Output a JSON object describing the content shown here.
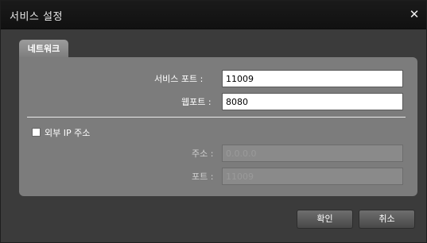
{
  "window": {
    "title": "서비스 설정",
    "close_icon": "close-icon"
  },
  "tab": {
    "label": "네트워크"
  },
  "fields": {
    "service_port": {
      "label": "서비스 포트 :",
      "value": "11009"
    },
    "web_port": {
      "label": "웹포트 :",
      "value": "8080"
    },
    "external_ip": {
      "label": "외부 IP 주소",
      "checked": false
    },
    "address": {
      "label": "주소 :",
      "value": "0.0.0.0"
    },
    "port": {
      "label": "포트 :",
      "value": "11009"
    }
  },
  "buttons": {
    "ok": "확인",
    "cancel": "취소"
  }
}
